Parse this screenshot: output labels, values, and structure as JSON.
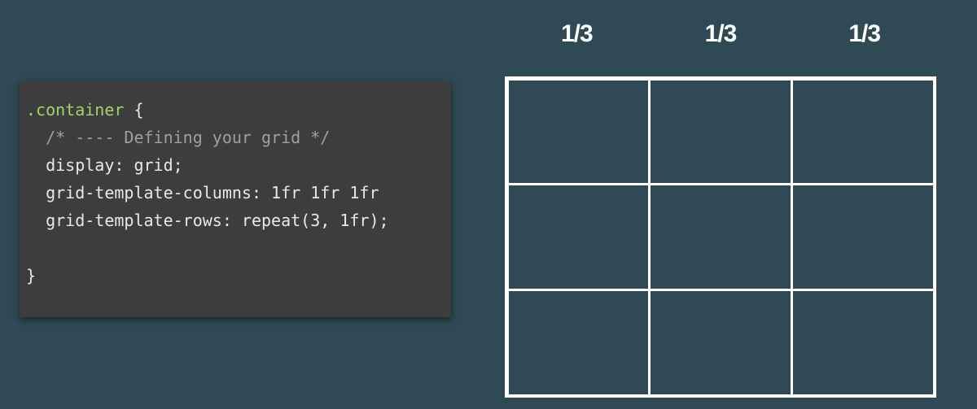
{
  "code": {
    "line1_selector": ".container",
    "line1_brace": " {",
    "line2_comment": "  /* ---- Defining your grid */",
    "line3_prop": "  display",
    "line3_sep": ": ",
    "line3_val": "grid;",
    "line4_prop": "  grid-template-columns",
    "line4_sep": ": ",
    "line4_val": "1fr 1fr 1fr",
    "line5_prop": "  grid-template-rows",
    "line5_sep": ": ",
    "line5_val": "repeat(3, 1fr);",
    "line7_brace": "}"
  },
  "grid_labels": {
    "col1": "1/3",
    "col2": "1/3",
    "col3": "1/3"
  }
}
